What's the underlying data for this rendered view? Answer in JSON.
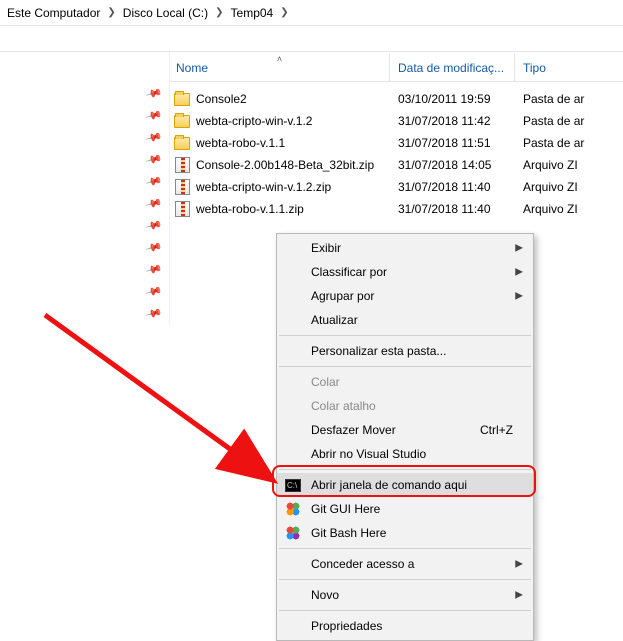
{
  "breadcrumb": {
    "items": [
      "Este Computador",
      "Disco Local (C:)",
      "Temp04"
    ]
  },
  "columns": {
    "name": "Nome",
    "date": "Data de modificaç...",
    "type": "Tipo"
  },
  "files": [
    {
      "name": "Console2",
      "date": "03/10/2011 19:59",
      "type": "Pasta de ar",
      "icon": "folder"
    },
    {
      "name": "webta-cripto-win-v.1.2",
      "date": "31/07/2018 11:42",
      "type": "Pasta de ar",
      "icon": "folder"
    },
    {
      "name": "webta-robo-v.1.1",
      "date": "31/07/2018 11:51",
      "type": "Pasta de ar",
      "icon": "folder"
    },
    {
      "name": "Console-2.00b148-Beta_32bit.zip",
      "date": "31/07/2018 14:05",
      "type": "Arquivo ZI",
      "icon": "zip"
    },
    {
      "name": "webta-cripto-win-v.1.2.zip",
      "date": "31/07/2018 11:40",
      "type": "Arquivo ZI",
      "icon": "zip"
    },
    {
      "name": "webta-robo-v.1.1.zip",
      "date": "31/07/2018 11:40",
      "type": "Arquivo ZI",
      "icon": "zip"
    }
  ],
  "context_menu": {
    "exibir": "Exibir",
    "classificar": "Classificar por",
    "agrupar": "Agrupar por",
    "atualizar": "Atualizar",
    "personalizar": "Personalizar esta pasta...",
    "colar": "Colar",
    "colar_atalho": "Colar atalho",
    "desfazer": "Desfazer Mover",
    "desfazer_shortcut": "Ctrl+Z",
    "abrir_vs": "Abrir no Visual Studio",
    "abrir_cmd": "Abrir janela de comando aqui",
    "git_gui": "Git GUI Here",
    "git_bash": "Git Bash Here",
    "conceder": "Conceder acesso a",
    "novo": "Novo",
    "propriedades": "Propriedades"
  }
}
